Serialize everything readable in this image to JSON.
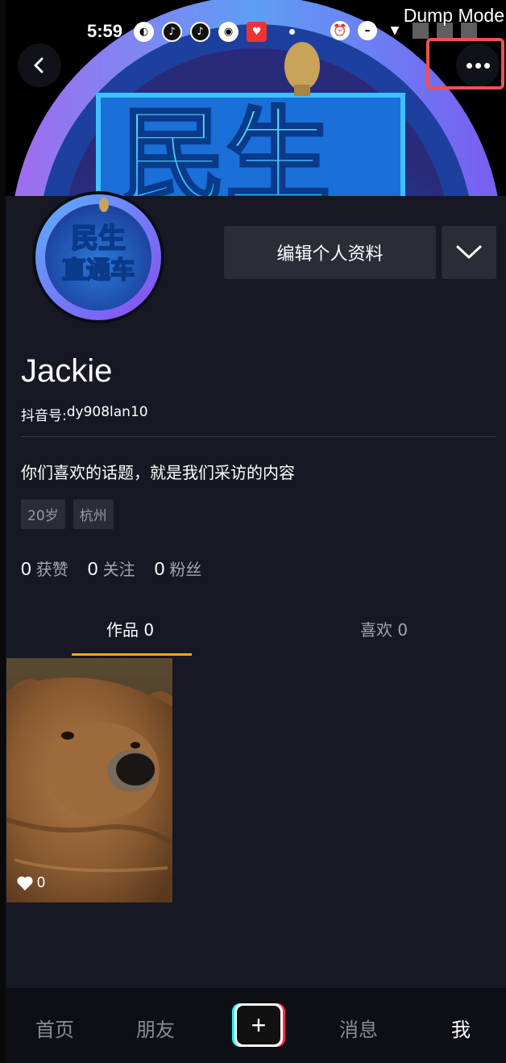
{
  "status_bar": {
    "time": "5:59",
    "overlay_label": "Dump Mode"
  },
  "banner": {
    "logo_text": "民生"
  },
  "profile": {
    "avatar_text_line1": "民生",
    "avatar_text_line2": "直通车",
    "edit_button_label": "编辑个人资料",
    "name": "Jackie",
    "douyin_id_label": "抖音号: ",
    "douyin_id_value": "dy908lan10",
    "bio": "你们喜欢的话题，就是我们采访的内容",
    "tags": [
      "20岁",
      "杭州"
    ]
  },
  "stats": {
    "likes_count": "0",
    "likes_label": "获赞",
    "following_count": "0",
    "following_label": "关注",
    "followers_count": "0",
    "followers_label": "粉丝"
  },
  "tabs": {
    "works_label": "作品 0",
    "likes_label": "喜欢 0"
  },
  "videos": [
    {
      "likes": "0"
    }
  ],
  "bottom_nav": {
    "home": "首页",
    "friends": "朋友",
    "add": "+",
    "messages": "消息",
    "me": "我"
  },
  "colors": {
    "background": "#161823",
    "tab_indicator": "#f5a623",
    "highlight_frame": "#f05050"
  }
}
